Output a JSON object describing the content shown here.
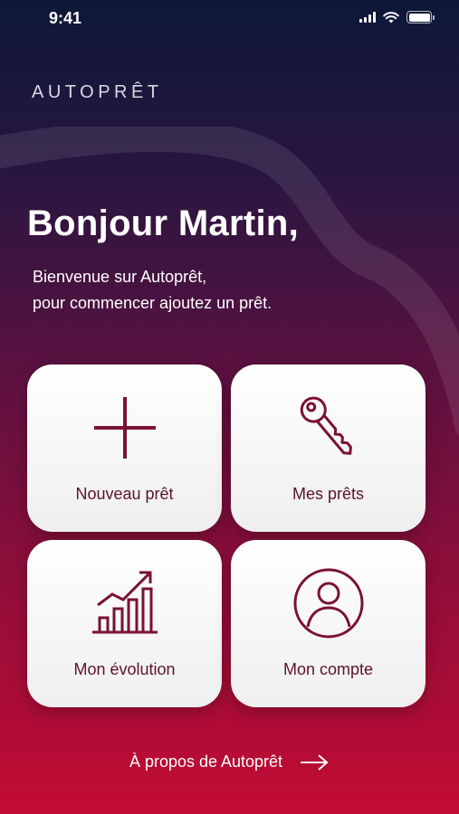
{
  "status_bar": {
    "time": "9:41"
  },
  "brand": "AUTOPRÊT",
  "greeting": "Bonjour Martin,",
  "subtitle": {
    "line1": "Bienvenue sur Autoprêt,",
    "line2": "pour commencer ajoutez un prêt."
  },
  "cards": [
    {
      "label": "Nouveau prêt",
      "icon": "plus-icon"
    },
    {
      "label": "Mes prêts",
      "icon": "key-icon"
    },
    {
      "label": "Mon évolution",
      "icon": "growth-chart-icon"
    },
    {
      "label": "Mon compte",
      "icon": "user-icon"
    }
  ],
  "about_link": {
    "label": "À propos de Autoprêt",
    "icon": "arrow-right-icon"
  },
  "colors": {
    "accent": "#7a1233",
    "label": "#5c1230"
  }
}
